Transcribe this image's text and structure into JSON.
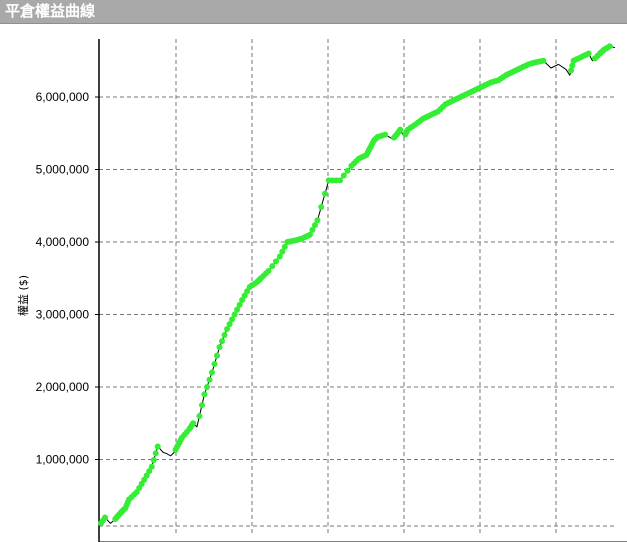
{
  "window": {
    "title": "平倉權益曲線"
  },
  "chart_data": {
    "type": "line",
    "title": "",
    "xlabel": "",
    "ylabel": "權益 ($)",
    "ylim": [
      0,
      6800000
    ],
    "yticks": [
      1000000,
      2000000,
      3000000,
      4000000,
      5000000,
      6000000
    ],
    "ytick_labels": [
      "1,000,000",
      "2,000,000",
      "3,000,000",
      "4,000,000",
      "5,000,000",
      "6,000,000"
    ],
    "xlim": [
      0,
      685
    ],
    "grid": true,
    "colors": {
      "line": "#000000",
      "highlight": "#33ee33",
      "grid": "#777777"
    },
    "x": [
      0,
      8,
      15,
      20,
      25,
      30,
      35,
      40,
      50,
      60,
      70,
      78,
      85,
      90,
      95,
      100,
      105,
      110,
      120,
      125,
      130,
      140,
      150,
      160,
      170,
      180,
      190,
      200,
      210,
      215,
      225,
      240,
      250,
      260,
      270,
      280,
      290,
      305,
      320,
      335,
      345,
      355,
      360,
      365,
      370,
      380,
      390,
      395,
      400,
      405,
      410,
      420,
      430,
      440,
      450,
      460,
      470,
      480,
      490,
      500,
      510,
      520,
      530,
      540,
      550,
      560,
      570,
      580,
      590,
      600,
      610,
      620,
      625,
      630,
      640,
      650,
      655,
      665,
      670,
      678,
      685
    ],
    "values": [
      80000,
      200000,
      120000,
      160000,
      220000,
      280000,
      330000,
      450000,
      550000,
      720000,
      900000,
      1180000,
      1100000,
      1080000,
      1050000,
      1100000,
      1200000,
      1300000,
      1420000,
      1500000,
      1450000,
      1900000,
      2200000,
      2550000,
      2800000,
      3000000,
      3200000,
      3380000,
      3450000,
      3500000,
      3600000,
      3800000,
      4000000,
      4020000,
      4050000,
      4100000,
      4300000,
      4850000,
      4850000,
      5050000,
      5150000,
      5200000,
      5300000,
      5400000,
      5450000,
      5480000,
      5420000,
      5480000,
      5550000,
      5450000,
      5550000,
      5620000,
      5700000,
      5750000,
      5800000,
      5900000,
      5950000,
      6000000,
      6050000,
      6100000,
      6150000,
      6200000,
      6230000,
      6300000,
      6350000,
      6400000,
      6450000,
      6480000,
      6500000,
      6400000,
      6450000,
      6380000,
      6300000,
      6500000,
      6550000,
      6600000,
      6500000,
      6600000,
      6650000,
      6700000,
      6680000
    ]
  }
}
